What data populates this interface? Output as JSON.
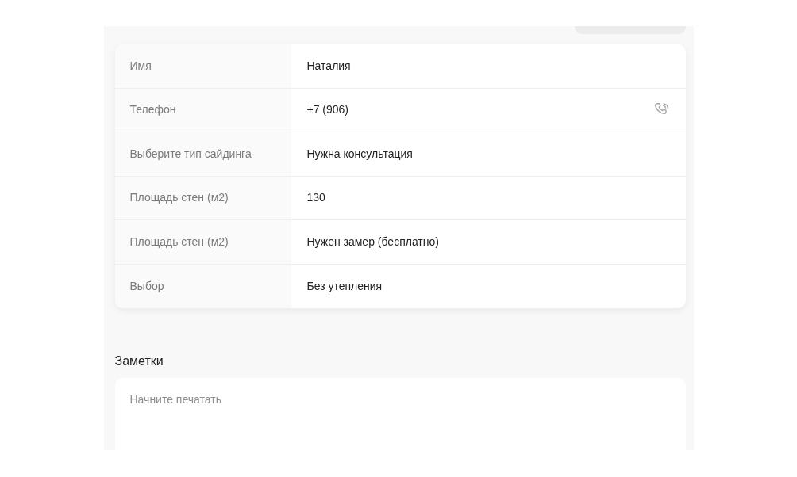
{
  "header": {
    "button_shown": true
  },
  "contact_card": {
    "rows": [
      {
        "kind": "text",
        "label": "Имя",
        "value": "Наталия"
      },
      {
        "kind": "phone",
        "label": "Телефон",
        "value": "+7 (906)"
      },
      {
        "kind": "text",
        "label": "Выберите тип сайдинга",
        "value": "Нужна консультация"
      },
      {
        "kind": "text",
        "label": "Площадь стен (м2)",
        "value": "130"
      },
      {
        "kind": "text",
        "label": "Площадь стен (м2)",
        "value": "Нужен замер (бесплатно)"
      },
      {
        "kind": "text",
        "label": "Выбор",
        "value": "Без утепления"
      }
    ]
  },
  "notes": {
    "title": "Заметки",
    "placeholder": "Начните печатать"
  }
}
